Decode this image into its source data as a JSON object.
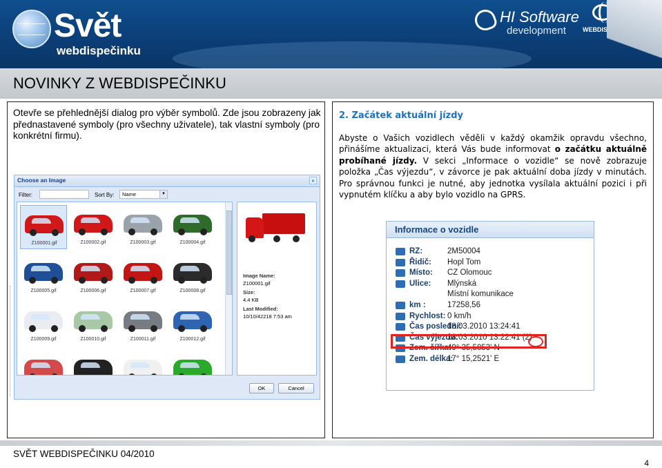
{
  "header": {
    "logo_title": "Svět",
    "logo_subtitle": "webdispečinku",
    "hi_software_title": "HI Software",
    "hi_software_subtitle": "development",
    "webdispecink_logo_text": "WEBDISPEČINK"
  },
  "page_title": "NOVINKY Z WEBDISPEČINKU",
  "left_panel": {
    "text": "Otevře se přehlednější dialog pro výběr symbolů. Zde jsou zobrazeny jak přednastavené symboly (pro všechny uživatele), tak vlastní symboly (pro konkrétní firmu).",
    "dialog": {
      "title": "Choose an Image",
      "filter_label": "Filter:",
      "filter_value": "",
      "sort_label": "Sort By:",
      "sort_value": "Name",
      "images": [
        {
          "name": "Z100001.gif",
          "color": "#d01818"
        },
        {
          "name": "Z100002.gif",
          "color": "#d01818"
        },
        {
          "name": "Z100003.gif",
          "color": "#9aa2aa"
        },
        {
          "name": "Z100004.gif",
          "color": "#2f6b2a"
        },
        {
          "name": "Z100005.gif",
          "color": "#1f4f99"
        },
        {
          "name": "Z100006.gif",
          "color": "#b21a1a"
        },
        {
          "name": "Z100007.gif",
          "color": "#c41515"
        },
        {
          "name": "Z100008.gif",
          "color": "#2b2b2b"
        },
        {
          "name": "Z100009.gif",
          "color": "#e9edf1"
        },
        {
          "name": "Z100010.gif",
          "color": "#a9c8a6"
        },
        {
          "name": "Z100011.gif",
          "color": "#777c82"
        },
        {
          "name": "Z100012.gif",
          "color": "#2f64b2"
        },
        {
          "name": "",
          "color": "#d24a4a"
        },
        {
          "name": "",
          "color": "#222222"
        },
        {
          "name": "",
          "color": "#f0f0f0"
        },
        {
          "name": "",
          "color": "#2aa92a"
        }
      ],
      "detail": {
        "image_name_label": "Image Name:",
        "image_name": "Z100001.gif",
        "size_label": "Size:",
        "size": "4.4 KB",
        "last_modified_label": "Last Modified:",
        "last_modified": "10/10/42218 7:53 am"
      },
      "ok_label": "OK",
      "cancel_label": "Cancel"
    }
  },
  "right_panel": {
    "heading": "2. Začátek aktuální jízdy",
    "paragraph_parts": {
      "p1": "Abyste o Vašich vozidlech věděli v každý okamžik opravdu všechno, přinášíme aktualizaci, která Vás bude informovat ",
      "p1_bold": "o začátku aktuálně probíhané jízdy.",
      "p2": " V sekci „Informace o vozidle“ se nově zobrazuje položka „Čas výjezdu“, v závorce je pak aktuální doba jízdy v minutách. Pro správnou funkci je nutné, aby jednotka vysílala aktuální pozici i při vypnutém klíčku a aby bylo vozidlo na GPRS."
    },
    "vehicle_info": {
      "title": "Informace o vozidle",
      "rows": [
        {
          "key": "RZ:",
          "value": "2M50004"
        },
        {
          "key": "Řidič:",
          "value": "Hopl Tom"
        },
        {
          "key": "Místo:",
          "value": "CZ Olomouc"
        },
        {
          "key": "Ulice:",
          "value": "Mlýnská"
        },
        {
          "key": "",
          "value": "Místní komunikace"
        },
        {
          "key": "km :",
          "value": "17258,56"
        },
        {
          "key": "Rychlost:",
          "value": "0 km/h"
        },
        {
          "key": "Čas poslední:",
          "value": "18.03.2010 13:24:41"
        },
        {
          "key": "Čas výjezdu:",
          "value": "18.03.2010 13:22:41 (2)"
        },
        {
          "key": "Zem. šířka:",
          "value": "49° 35,5853' N"
        },
        {
          "key": "Zem. délka:",
          "value": "17° 15,2521' E"
        }
      ]
    }
  },
  "footer": {
    "text": "SVĚT WEBDISPEČINKU 04/2010",
    "page_number": "4"
  }
}
